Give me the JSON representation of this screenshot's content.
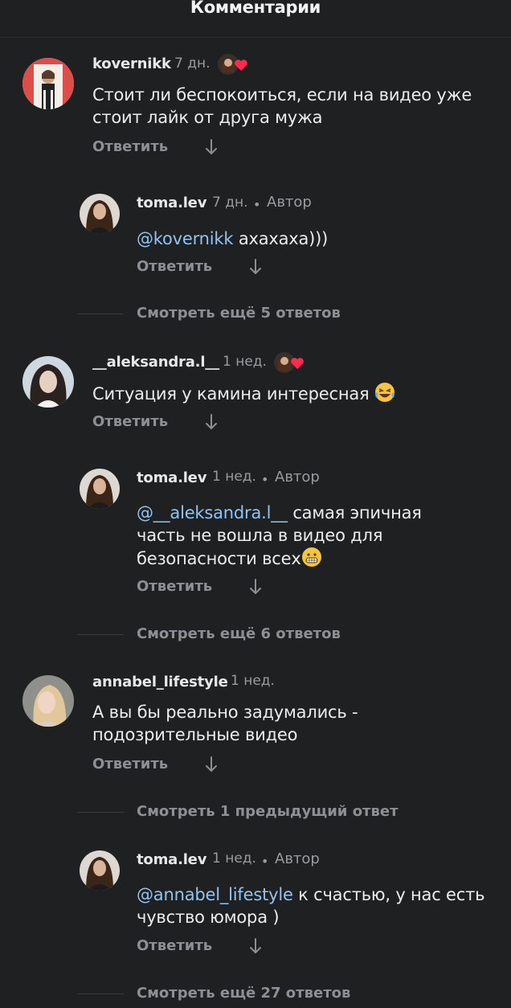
{
  "header": {
    "title": "Комментарии"
  },
  "reply_label": "Ответить",
  "author_label": "Автор",
  "separator": "•",
  "comments": [
    {
      "username": "kovernikk",
      "time": "7 дн.",
      "text": "Стоит ли беспокоиться, если на видео уже стоит лайк от друга мужа",
      "liked_by_author": true,
      "reply": {
        "username": "toma.lev",
        "time": "7 дн.",
        "mention": "@kovernikk",
        "text": " ахахаха)))"
      },
      "more_text": "Смотреть ещё 5 ответов"
    },
    {
      "username": "__aleksandra.l__",
      "time": "1 нед.",
      "text": "Ситуация у камина интересная ",
      "emoji": "laughing-tears-emoji",
      "liked_by_author": true,
      "reply": {
        "username": "toma.lev",
        "time": "1 нед.",
        "mention": "@__aleksandra.l__",
        "text": " самая эпичная часть не вошла в видео для безопасности всех",
        "emoji": "grinning-emoji"
      },
      "more_text": "Смотреть ещё 6 ответов"
    },
    {
      "username": "annabel_lifestyle",
      "time": "1 нед.",
      "text": "А вы бы реально задумались - подозрительные видео",
      "liked_by_author": false,
      "previous_text": "Смотреть 1 предыдущий ответ",
      "reply": {
        "username": "toma.lev",
        "time": "1 нед.",
        "mention": "@annabel_lifestyle",
        "text": " к счастью, у нас есть чувство юмора )"
      },
      "more_text": "Смотреть ещё 27 ответов"
    }
  ],
  "colors": {
    "background": "#1f2022",
    "mention": "#8fc4f2",
    "like_heart": "#ff2a4d",
    "secondary_text": "#8e8f94"
  }
}
